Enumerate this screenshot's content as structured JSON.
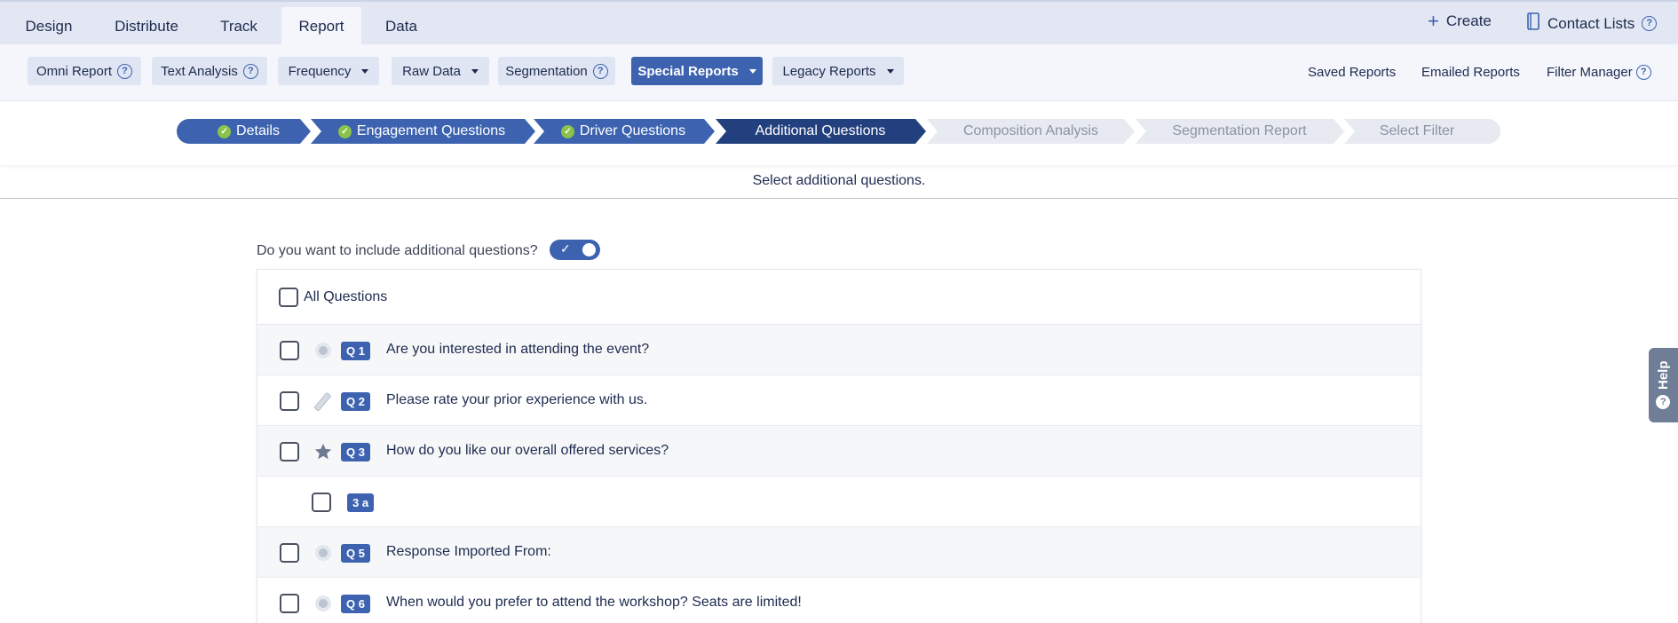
{
  "topnav": {
    "tabs": [
      "Design",
      "Distribute",
      "Track",
      "Report",
      "Data"
    ],
    "active_tab": "Report",
    "create_label": "Create",
    "contact_lists_label": "Contact Lists"
  },
  "subbar": {
    "omni_report": "Omni Report",
    "text_analysis": "Text Analysis",
    "frequency": "Frequency",
    "raw_data": "Raw Data",
    "segmentation": "Segmentation",
    "special_reports": "Special Reports",
    "legacy_reports": "Legacy Reports",
    "saved_reports": "Saved Reports",
    "emailed_reports": "Emailed Reports",
    "filter_manager": "Filter Manager"
  },
  "stepper": {
    "steps": [
      {
        "label": "Details",
        "state": "done"
      },
      {
        "label": "Engagement Questions",
        "state": "done"
      },
      {
        "label": "Driver Questions",
        "state": "done"
      },
      {
        "label": "Additional Questions",
        "state": "current"
      },
      {
        "label": "Composition Analysis",
        "state": "todo"
      },
      {
        "label": "Segmentation Report",
        "state": "todo"
      },
      {
        "label": "Select Filter",
        "state": "todo"
      }
    ]
  },
  "instruction": "Select additional questions.",
  "include": {
    "label": "Do you want to include additional questions?",
    "toggle_on": true
  },
  "questions": {
    "all_label": "All Questions",
    "rows": [
      {
        "badge": "Q 1",
        "text": "Are you interested in attending the event?",
        "icon": "radio-icon"
      },
      {
        "badge": "Q 2",
        "text": "Please rate your prior experience with us.",
        "icon": "slider-icon"
      },
      {
        "badge": "Q 3",
        "text": "How do you like our overall offered services?",
        "icon": "star-icon"
      },
      {
        "badge": "3 a",
        "text": "",
        "icon": "none"
      },
      {
        "badge": "Q 5",
        "text": "Response Imported From:",
        "icon": "radio-icon"
      },
      {
        "badge": "Q 6",
        "text": "When would you prefer to attend the workshop? Seats are limited!",
        "icon": "radio-icon"
      }
    ]
  },
  "help_tab": "Help",
  "colors": {
    "primary": "#3d63b0",
    "primary_dark": "#23407e",
    "check_green": "#8bc34a",
    "nav_bg": "#e2e7f3"
  }
}
